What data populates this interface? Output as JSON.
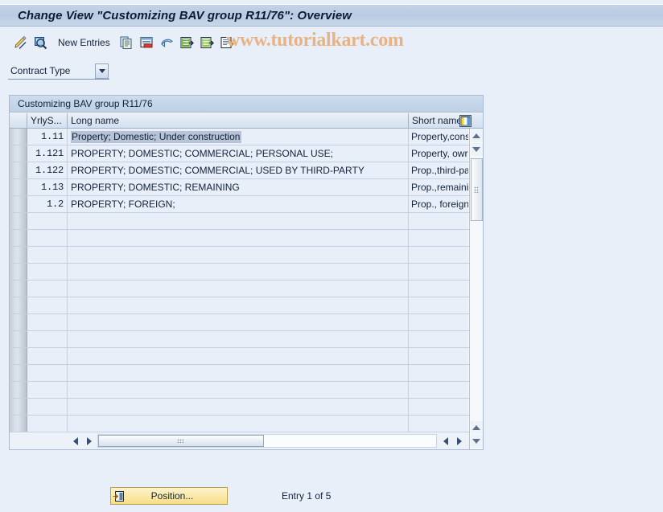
{
  "window": {
    "title": "Change View \"Customizing BAV group R11/76\": Overview"
  },
  "watermark": {
    "text": "www.tutorialkart.com",
    "color": "#e8b384"
  },
  "toolbar": {
    "new_entries_label": "New Entries",
    "icons": [
      {
        "name": "pencil-display-change-icon",
        "title": "Display/Change"
      },
      {
        "name": "magnifier-display-icon",
        "title": "Other view"
      },
      {
        "name": "copy-as-icon",
        "title": "Copy As..."
      },
      {
        "name": "delete-row-icon",
        "title": "Delete"
      },
      {
        "name": "undo-icon",
        "title": "Undo"
      },
      {
        "name": "select-all-icon",
        "title": "Select All"
      },
      {
        "name": "deselect-all-icon",
        "title": "Deselect All"
      },
      {
        "name": "variant-icon",
        "title": "Select Block"
      }
    ]
  },
  "filter": {
    "contract_type_label": "Contract Type",
    "dropdown_icon": "chevron-down-icon"
  },
  "panel": {
    "title": "Customizing BAV group R11/76",
    "settings_icon": "table-settings-icon"
  },
  "table": {
    "columns": [
      {
        "key": "selector",
        "label": ""
      },
      {
        "key": "yrly",
        "label": "YrlyS..."
      },
      {
        "key": "long",
        "label": "Long name"
      },
      {
        "key": "short",
        "label": "Short name"
      }
    ],
    "rows": [
      {
        "yrly": "1.11",
        "long": "Property; Domestic; Under construction",
        "short": "Property,cons",
        "selected": true
      },
      {
        "yrly": "1.121",
        "long": "PROPERTY; DOMESTIC; COMMERCIAL; PERSONAL USE;",
        "short": "Property, owr",
        "selected": false
      },
      {
        "yrly": "1.122",
        "long": "PROPERTY; DOMESTIC; COMMERCIAL; USED BY THIRD-PARTY",
        "short": "Prop.,third-pa",
        "selected": false
      },
      {
        "yrly": "1.13",
        "long": "PROPERTY; DOMESTIC; REMAINING",
        "short": "Prop.,remainir",
        "selected": false
      },
      {
        "yrly": "1.2",
        "long": "PROPERTY; FOREIGN;",
        "short": "Prop., foreign",
        "selected": false
      }
    ],
    "empty_row_count": 13
  },
  "footer": {
    "position_button_label": "Position...",
    "position_button_icon": "position-arrow-icon",
    "entry_status": "Entry 1 of 5"
  },
  "colors": {
    "background": "#e9eff8",
    "titlebar": "#bfd0e6",
    "row_bg": "#e9eff8",
    "selection": "#b7c3d6",
    "button_yellow": "#fbe9a8"
  }
}
